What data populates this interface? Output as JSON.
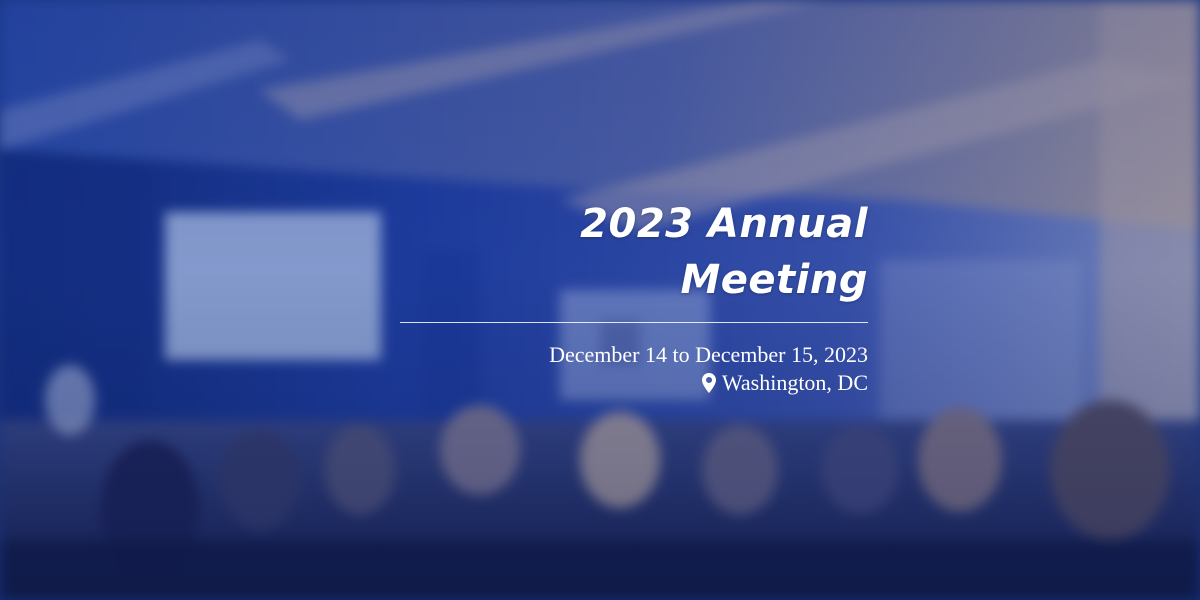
{
  "event": {
    "title": "2023 Annual Meeting",
    "dates": "December 14 to December 15, 2023",
    "location": "Washington, DC"
  },
  "icons": {
    "location": "map-pin-icon"
  },
  "colors": {
    "text": "#ffffff",
    "overlay": "#1d3d8a"
  }
}
